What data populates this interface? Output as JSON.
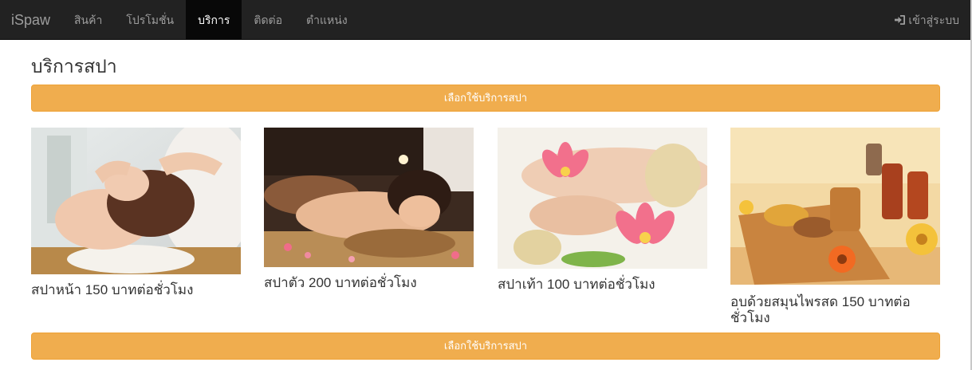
{
  "navbar": {
    "brand": "iSpaw",
    "items": [
      {
        "label": "สินค้า"
      },
      {
        "label": "โปรโมชั่น"
      },
      {
        "label": "บริการ"
      },
      {
        "label": "ติดต่อ"
      },
      {
        "label": "ตำแหน่ง"
      }
    ],
    "active_index": 2,
    "login_label": "เข้าสู่ระบบ",
    "login_icon": "sign-in-icon"
  },
  "main": {
    "title": "บริการสปา",
    "select_button_label": "เลือกใช้บริการสปา",
    "services": [
      {
        "caption": "สปาหน้า 150 บาทต่อชั่วโมง",
        "image": "facial-spa-photo"
      },
      {
        "caption": "สปาตัว 200 บาทต่อชั่วโมง",
        "image": "body-spa-photo"
      },
      {
        "caption": "สปาเท้า 100 บาทต่อชั่วโมง",
        "image": "foot-spa-photo"
      },
      {
        "caption": "อบด้วยสมุนไพรสด 150 บาทต่อชั่วโมง",
        "image": "herbal-steam-photo"
      }
    ]
  },
  "colors": {
    "navbar_bg": "#222222",
    "nav_active_bg": "#080808",
    "button_warning": "#f0ad4e"
  }
}
